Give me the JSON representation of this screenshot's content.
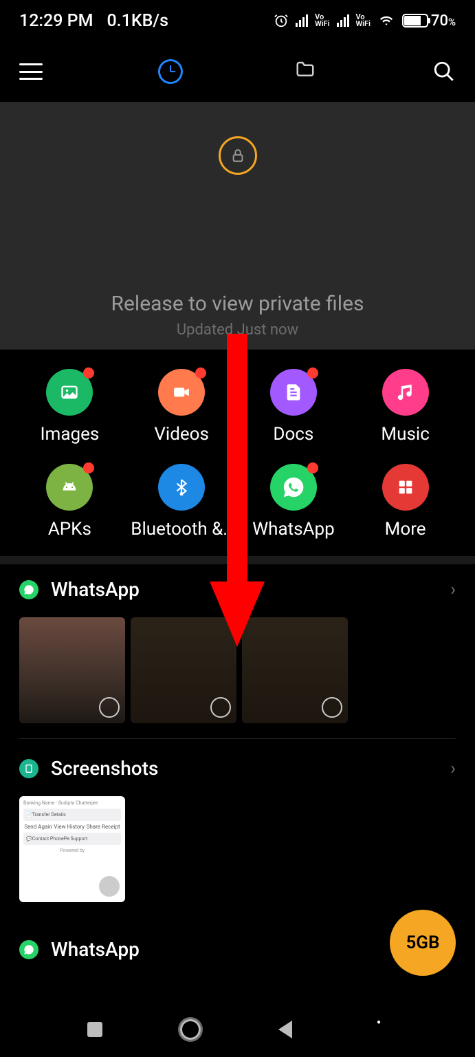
{
  "status": {
    "time": "12:29 PM",
    "net_speed": "0.1KB/s",
    "vowifi": "Vo\nWiFi",
    "battery_pct": "70",
    "battery_pct_sym": "%"
  },
  "pull": {
    "title": "Release to view private files",
    "subtitle": "Updated Just now"
  },
  "categories": [
    {
      "label": "Images",
      "color": "green",
      "badge": true,
      "icon": "image-icon"
    },
    {
      "label": "Videos",
      "color": "orange",
      "badge": true,
      "icon": "video-icon"
    },
    {
      "label": "Docs",
      "color": "purple",
      "badge": true,
      "icon": "docs-icon"
    },
    {
      "label": "Music",
      "color": "pink",
      "badge": false,
      "icon": "music-icon"
    },
    {
      "label": "APKs",
      "color": "lime",
      "badge": true,
      "icon": "apk-icon"
    },
    {
      "label": "Bluetooth &..",
      "color": "blue",
      "badge": false,
      "icon": "bluetooth-icon"
    },
    {
      "label": "WhatsApp",
      "color": "wgreen",
      "badge": true,
      "icon": "whatsapp-icon"
    },
    {
      "label": "More",
      "color": "red",
      "badge": false,
      "icon": "more-icon"
    }
  ],
  "sections": {
    "whatsapp": {
      "title": "WhatsApp"
    },
    "screenshots": {
      "title": "Screenshots"
    },
    "whatsapp2": {
      "title": "WhatsApp"
    }
  },
  "fab": {
    "label": "5GB"
  },
  "screenshot_preview": {
    "line1": "Banking Name · Sudipta Chatterjee",
    "transfer": "Transfer Details",
    "actions": [
      "Send Again",
      "View History",
      "Share Receipt"
    ],
    "support": "Contact PhonePe Support",
    "powered": "Powered by"
  }
}
